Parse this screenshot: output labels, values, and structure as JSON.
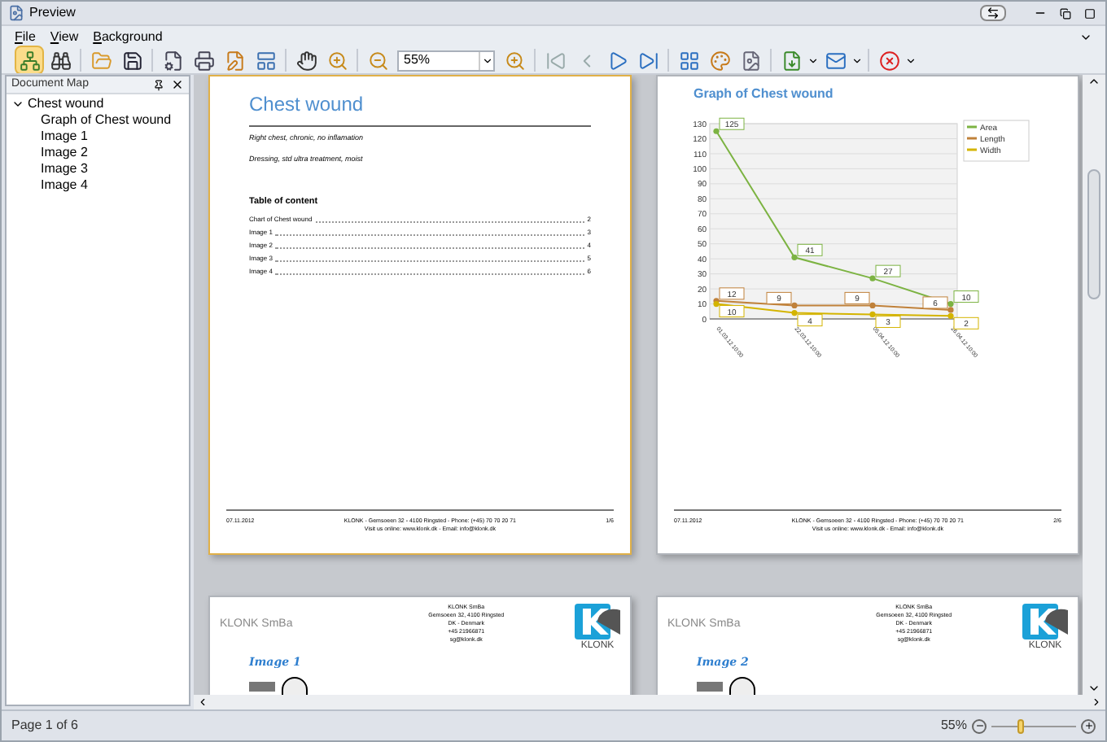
{
  "window": {
    "title": "Preview"
  },
  "menu": [
    {
      "label": "File"
    },
    {
      "label": "View"
    },
    {
      "label": "Background"
    }
  ],
  "toolbar": {
    "zoom": "55%"
  },
  "document_map": {
    "title": "Document Map",
    "items": [
      {
        "label": "Chest wound",
        "expanded": true,
        "children": [
          {
            "label": "Graph of Chest wound"
          },
          {
            "label": "Image 1"
          },
          {
            "label": "Image 2"
          },
          {
            "label": "Image 3"
          },
          {
            "label": "Image 4"
          }
        ]
      }
    ]
  },
  "pages": [
    {
      "kind": "cover",
      "selected": true,
      "title": "Chest wound",
      "lines": [
        "Right chest, chronic, no inflamation",
        "Dressing, std ultra treatment, moist"
      ],
      "toc_title": "Table of content",
      "toc": [
        {
          "label": "Chart of Chest wound",
          "page": "2"
        },
        {
          "label": "Image 1",
          "page": "3"
        },
        {
          "label": "Image 2",
          "page": "4"
        },
        {
          "label": "Image 3",
          "page": "5"
        },
        {
          "label": "Image 4",
          "page": "6"
        }
      ],
      "footer": {
        "date": "07.11.2012",
        "address": "KLONK - Gemsoeen 32 - 4100 Ringsted - Phone: (+45) 70 70 20 71",
        "web": "Visit us online: www.klonk.dk - Email: info@klonk.dk",
        "page": "1/6"
      }
    },
    {
      "kind": "chart",
      "selected": false,
      "title": "Graph of Chest wound",
      "chart_data": {
        "type": "line",
        "categories": [
          "01.03.12 10:00",
          "22.03.12 10:00",
          "05.04.12 10:00",
          "26.04.12 10:00"
        ],
        "series": [
          {
            "name": "Area",
            "color": "#7cb342",
            "marker": "circle",
            "values": [
              125,
              41,
              27,
              10
            ]
          },
          {
            "name": "Length",
            "color": "#c0813a",
            "marker": "circle",
            "values": [
              12,
              9,
              9,
              6
            ]
          },
          {
            "name": "Width",
            "color": "#d4b400",
            "marker": "circle",
            "values": [
              10,
              4,
              3,
              2
            ]
          }
        ],
        "grid": true,
        "legend": "right",
        "ylim": [
          0,
          130
        ],
        "yticks": [
          0,
          10,
          20,
          30,
          40,
          50,
          60,
          70,
          80,
          90,
          100,
          110,
          120,
          130
        ],
        "data_labels": true
      },
      "footer": {
        "date": "07.11.2012",
        "address": "KLONK - Gemsoeen 32 - 4100 Ringsted - Phone: (+45) 70 70 20 71",
        "web": "Visit us online: www.klonk.dk - Email: info@klonk.dk",
        "page": "2/6"
      }
    },
    {
      "kind": "image",
      "selected": false,
      "company": "KLONK SmBa",
      "address_lines": [
        "KLONK SmBa",
        "Gemsoeen 32, 4100 Ringsted",
        "DK - Denmark",
        "+45 21966871",
        "sg@klonk.dk"
      ],
      "logo": "KLONK",
      "heading": "Image 1"
    },
    {
      "kind": "image",
      "selected": false,
      "company": "KLONK SmBa",
      "address_lines": [
        "KLONK SmBa",
        "Gemsoeen 32, 4100 Ringsted",
        "DK - Denmark",
        "+45 21966871",
        "sg@klonk.dk"
      ],
      "logo": "KLONK",
      "heading": "Image 2"
    }
  ],
  "status_bar": {
    "page": "Page 1 of 6",
    "zoom": "55%",
    "level": 0.35
  }
}
